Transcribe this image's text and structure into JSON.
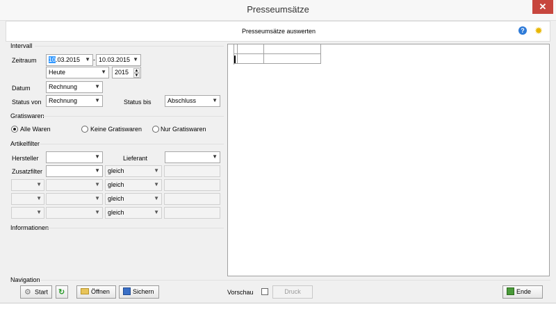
{
  "window": {
    "title": "Presseumsätze",
    "close_label": "✕"
  },
  "header": {
    "title": "Presseumsätze auswerten",
    "help_icon": "help-icon",
    "settings_icon": "gear-icon"
  },
  "intervall": {
    "group_label": "Intervall",
    "zeitraum_label": "Zeitraum",
    "date_from_sel": "10",
    "date_from_rest": ".03.2015",
    "date_sep": "-",
    "date_to": "10.03.2015",
    "period_value": "Heute",
    "year_value": "2015",
    "datum_label": "Datum",
    "datum_value": "Rechnung",
    "status_von_label": "Status von",
    "status_von_value": "Rechnung",
    "status_bis_label": "Status bis",
    "status_bis_value": "Abschluss"
  },
  "gratiswaren": {
    "group_label": "Gratiswaren",
    "options": [
      "Alle Waren",
      "Keine Gratiswaren",
      "Nur Gratiswaren"
    ],
    "selected": "Alle Waren"
  },
  "artikelfilter": {
    "group_label": "Artikelfilter",
    "hersteller_label": "Hersteller",
    "lieferant_label": "Lieferant",
    "zusatzfilter_label": "Zusatzfilter",
    "operator": "gleich"
  },
  "informationen": {
    "group_label": "Informationen"
  },
  "navigation": {
    "group_label": "Navigation",
    "start_label": "Start",
    "offnen_label": "Öffnen",
    "sichern_label": "Sichern",
    "vorschau_label": "Vorschau",
    "druck_label": "Druck",
    "ende_label": "Ende"
  }
}
